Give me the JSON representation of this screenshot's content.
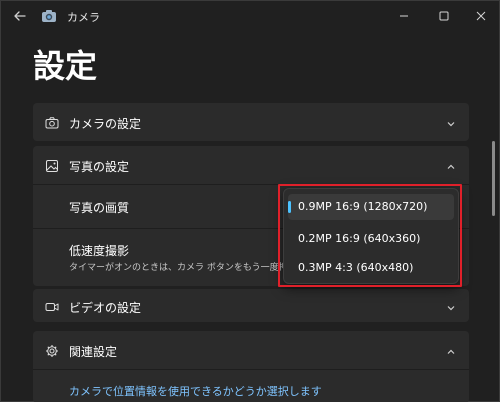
{
  "titlebar": {
    "app_name": "カメラ",
    "icons": {
      "back": "back-arrow-icon",
      "app": "camera-app-icon",
      "min": "minimize-icon",
      "max": "maximize-icon",
      "close": "close-icon"
    }
  },
  "page": {
    "title": "設定"
  },
  "sections": {
    "camera": {
      "label": "カメラの設定",
      "icon": "camera-icon",
      "expanded": false
    },
    "photo": {
      "label": "写真の設定",
      "icon": "image-icon",
      "expanded": true,
      "quality_label": "写真の画質",
      "lowlight_label": "低速度撮影",
      "lowlight_desc": "タイマーがオンのときは、カメラ ボタンをもう一度押すまで、"
    },
    "video": {
      "label": "ビデオの設定",
      "icon": "video-icon",
      "expanded": false
    },
    "related": {
      "label": "関連設定",
      "icon": "gear-icon",
      "expanded": true,
      "link": "カメラで位置情報を使用できるかどうか選択します"
    }
  },
  "dropdown": {
    "selected_index": 0,
    "options": [
      "0.9MP 16:9 (1280x720)",
      "0.2MP 16:9 (640x360)",
      "0.3MP 4:3 (640x480)"
    ]
  },
  "colors": {
    "accent": "#4cc2ff",
    "link": "#7fc4ff",
    "highlight_border": "#e0202a"
  }
}
